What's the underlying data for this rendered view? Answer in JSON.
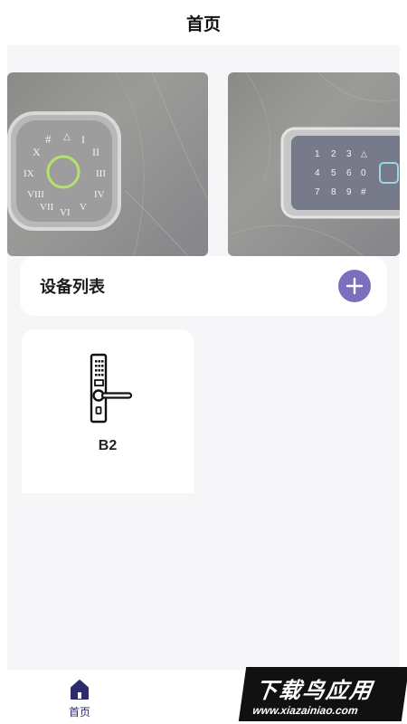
{
  "header": {
    "title": "首页"
  },
  "banners": [
    {
      "name": "round-keypad-lock",
      "keys": [
        "#",
        "I",
        "II",
        "III",
        "IV",
        "V",
        "VI",
        "VII",
        "VIII",
        "IX",
        "X"
      ]
    },
    {
      "name": "rectangular-keypad-lock",
      "keys": [
        "1",
        "2",
        "3",
        "4",
        "5",
        "6",
        "0",
        "7",
        "8",
        "9",
        "#"
      ]
    }
  ],
  "devices_section": {
    "title": "设备列表",
    "add_icon": "plus-icon"
  },
  "devices": [
    {
      "name": "B2",
      "icon": "door-lock-icon"
    }
  ],
  "tabbar": {
    "items": [
      {
        "label": "首页",
        "icon": "home-icon",
        "active": true
      }
    ]
  },
  "watermark": {
    "main": "下载鸟应用",
    "sub": "www.xiazainiao.com"
  },
  "colors": {
    "accent": "#7b70bd",
    "tab_active": "#2d2a6e",
    "background": "#f6f6f8"
  }
}
